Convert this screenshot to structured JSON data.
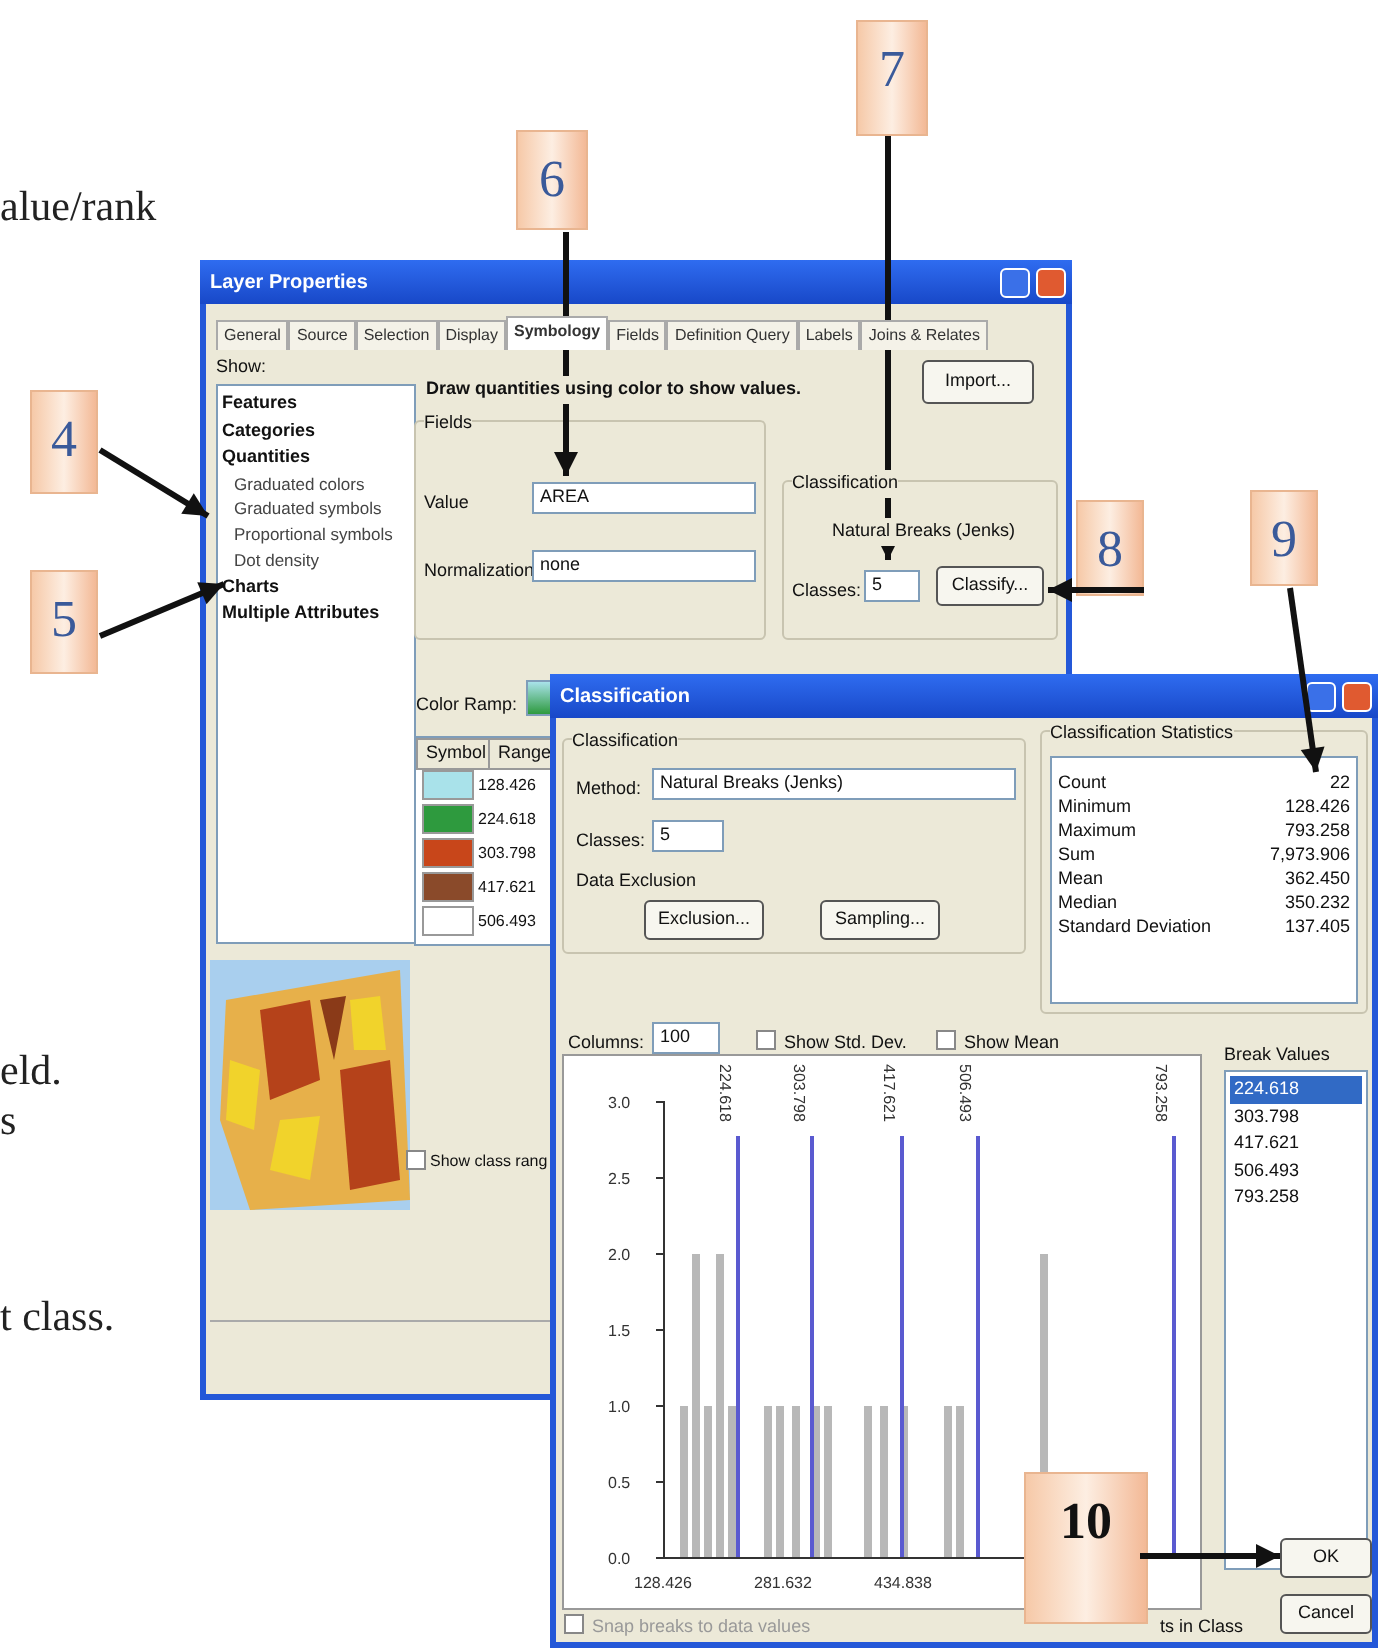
{
  "document_text": [
    "alue/rank",
    "eld.",
    "s",
    "t class."
  ],
  "callouts": [
    "4",
    "5",
    "6",
    "7",
    "8",
    "9",
    "10"
  ],
  "layer_properties": {
    "title": "Layer Properties",
    "tabs": [
      {
        "label": "General",
        "selected": false
      },
      {
        "label": "Source",
        "selected": false
      },
      {
        "label": "Selection",
        "selected": false
      },
      {
        "label": "Display",
        "selected": false
      },
      {
        "label": "Symbology",
        "selected": true
      },
      {
        "label": "Fields",
        "selected": false
      },
      {
        "label": "Definition Query",
        "selected": false
      },
      {
        "label": "Labels",
        "selected": false
      },
      {
        "label": "Joins & Relates",
        "selected": false
      }
    ],
    "show_label": "Show:",
    "show_items": [
      {
        "label": "Features"
      },
      {
        "label": "Categories"
      },
      {
        "label": "Quantities",
        "children": [
          {
            "label": "Graduated colors"
          },
          {
            "label": "Graduated symbols"
          },
          {
            "label": "Proportional symbols"
          },
          {
            "label": "Dot density"
          }
        ]
      },
      {
        "label": "Charts"
      },
      {
        "label": "Multiple Attributes"
      }
    ],
    "heading": "Draw quantities using color to show values.",
    "import_button": "Import...",
    "fields": {
      "title": "Fields",
      "value_label": "Value",
      "value": "AREA",
      "normalization_label": "Normalization",
      "normalization": "none"
    },
    "classification": {
      "title": "Classification",
      "method": "Natural Breaks (Jenks)",
      "classes_label": "Classes:",
      "classes": "5",
      "classify_button": "Classify..."
    },
    "color_ramp_label": "Color Ramp:",
    "symbol_table": {
      "columns": [
        "Symbol",
        "Range"
      ],
      "rows": [
        {
          "color": "#a9e2ea",
          "range": "128.426"
        },
        {
          "color": "#2e9a3e",
          "range": "224.618"
        },
        {
          "color": "#c8461a",
          "range": "303.798"
        },
        {
          "color": "#8a4a2a",
          "range": "417.621"
        },
        {
          "color": "#ffffff",
          "range": "506.493"
        }
      ]
    },
    "show_class_ranges": {
      "label": "Show class rang",
      "checked": false
    }
  },
  "classification_dialog": {
    "title": "Classification",
    "group_title": "Classification",
    "method_label": "Method:",
    "method": "Natural Breaks (Jenks)",
    "classes_label": "Classes:",
    "classes": "5",
    "data_exclusion": "Data Exclusion",
    "buttons": [
      "Exclusion...",
      "Sampling..."
    ],
    "statistics": {
      "title": "Classification Statistics",
      "rows": [
        {
          "label": "Count",
          "value": "22"
        },
        {
          "label": "Minimum",
          "value": "128.426"
        },
        {
          "label": "Maximum",
          "value": "793.258"
        },
        {
          "label": "Sum",
          "value": "7,973.906"
        },
        {
          "label": "Mean",
          "value": "362.450"
        },
        {
          "label": "Median",
          "value": "350.232"
        },
        {
          "label": "Standard Deviation",
          "value": "137.405"
        }
      ]
    },
    "columns_label": "Columns:",
    "columns": "100",
    "options": [
      {
        "label": "Show Std. Dev.",
        "checked": false
      },
      {
        "label": "Show Mean",
        "checked": false
      }
    ],
    "histogram": {
      "y_labels": [
        "3.0",
        "2.5",
        "2.0",
        "1.5",
        "1.0",
        "0.5",
        "0.0"
      ],
      "x_labels": [
        "128.426",
        "281.632",
        "434.838"
      ],
      "break_labels": [
        "224.618",
        "303.798",
        "417.621",
        "506.493",
        "793.258"
      ]
    },
    "break_values_title": "Break Values",
    "break_values": [
      {
        "value": "224.618",
        "selected": true
      },
      {
        "value": "303.798",
        "selected": false
      },
      {
        "value": "417.621",
        "selected": false
      },
      {
        "value": "506.493",
        "selected": false
      },
      {
        "value": "793.258",
        "selected": false
      }
    ],
    "snap_option": {
      "label": "Snap breaks to data values",
      "checked": false
    },
    "elements_label": "ts in Class",
    "ok_button": "OK",
    "cancel_button": "Cancel"
  }
}
